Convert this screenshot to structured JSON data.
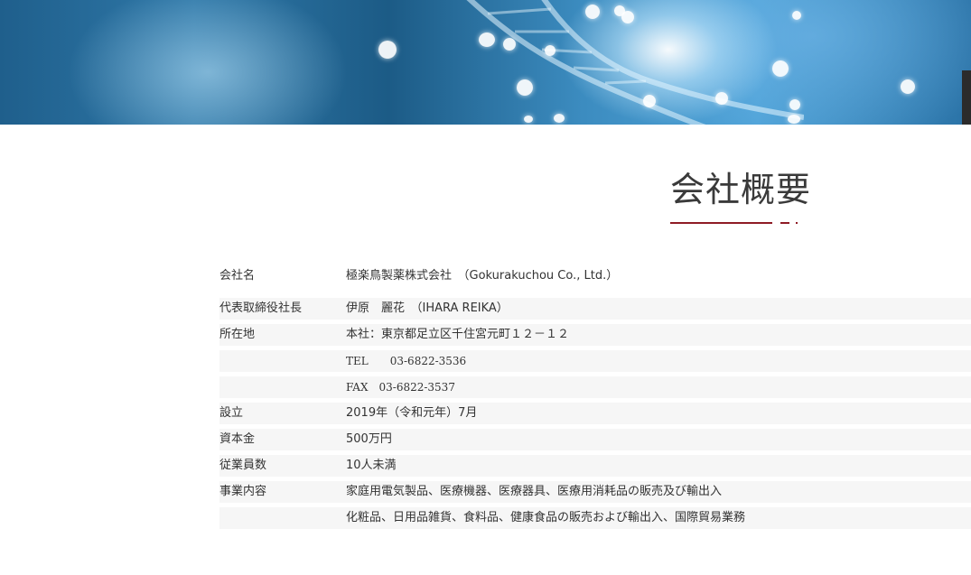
{
  "page": {
    "title": "会社概要"
  },
  "company": {
    "rows": [
      {
        "label": "会社名",
        "value": "極楽鳥製薬株式会社　（Gokurakuchou Co., Ltd.）"
      },
      {
        "label": "代表取締役社長",
        "value": "伊原　麗花　（IHARA REIKA）"
      },
      {
        "label": "所在地",
        "value": "本社：東京都足立区千住宮元町１２－１２"
      },
      {
        "label": "",
        "value": "TEL　　03-6822-3536"
      },
      {
        "label": "",
        "value": "FAX　03-6822-3537"
      },
      {
        "label": "設立",
        "value": "2019年（令和元年）7月"
      },
      {
        "label": "資本金",
        "value": "500万円"
      },
      {
        "label": "従業員数",
        "value": "10人未満"
      },
      {
        "label": "事業内容",
        "value": "家庭用電気製品、医療機器、医療器具、医療用消耗品の販売及び輸出入"
      },
      {
        "label": "",
        "value": "化粧品、日用品雑貨、食料品、健康食品の販売および輸出入、国際貿易業務"
      }
    ]
  },
  "colors": {
    "accent": "#8f1b25",
    "row_shade": "#f6f6f6"
  }
}
